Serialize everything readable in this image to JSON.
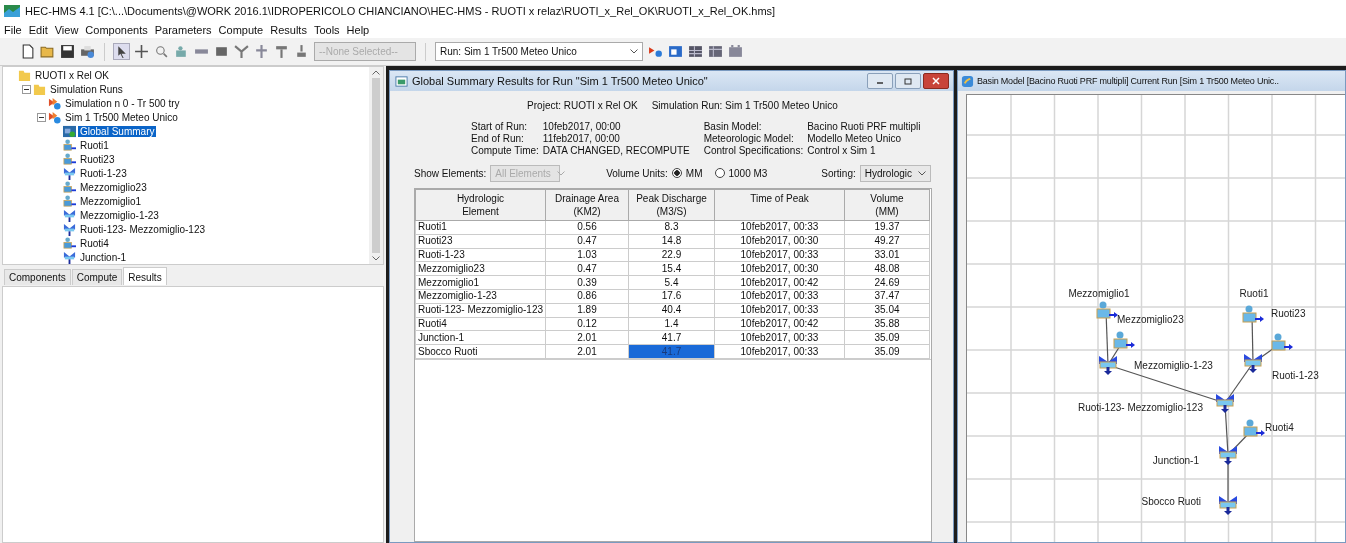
{
  "window": {
    "title": "HEC-HMS 4.1 [C:\\...\\Documents\\@WORK 2016.1\\IDROPERICOLO CHIANCIANO\\HEC-HMS - RUOTI x relaz\\RUOTI_x_Rel_OK\\RUOTI_x_Rel_OK.hms]"
  },
  "menu": [
    "File",
    "Edit",
    "View",
    "Components",
    "Parameters",
    "Compute",
    "Results",
    "Tools",
    "Help"
  ],
  "toolbar": {
    "element_select": {
      "value": "--None Selected--",
      "disabled": true
    },
    "run_select": {
      "value": "Run: Sim 1 Tr500 Meteo Unico"
    }
  },
  "tree": [
    {
      "label": "RUOTI x Rel OK",
      "kind": "project",
      "selected": false,
      "children": [
        {
          "label": "Simulation Runs",
          "kind": "folder",
          "expanded": true,
          "selected": false,
          "children": [
            {
              "label": "Simulation n 0 - Tr 500 try",
              "kind": "run",
              "selected": false
            },
            {
              "label": "Sim 1 Tr500 Meteo Unico",
              "kind": "run",
              "expanded": true,
              "selected": false,
              "children": [
                {
                  "label": "Global Summary",
                  "kind": "summary",
                  "selected": true
                },
                {
                  "label": "Ruoti1",
                  "kind": "subbasin",
                  "selected": false
                },
                {
                  "label": "Ruoti23",
                  "kind": "subbasin",
                  "selected": false
                },
                {
                  "label": "Ruoti-1-23",
                  "kind": "junction",
                  "selected": false
                },
                {
                  "label": "Mezzomiglio23",
                  "kind": "subbasin",
                  "selected": false
                },
                {
                  "label": "Mezzomiglio1",
                  "kind": "subbasin",
                  "selected": false
                },
                {
                  "label": "Mezzomiglio-1-23",
                  "kind": "junction",
                  "selected": false
                },
                {
                  "label": "Ruoti-123- Mezzomiglio-123",
                  "kind": "junction",
                  "selected": false
                },
                {
                  "label": "Ruoti4",
                  "kind": "subbasin",
                  "selected": false
                },
                {
                  "label": "Junction-1",
                  "kind": "junction",
                  "selected": false
                }
              ]
            }
          ]
        }
      ]
    }
  ],
  "tabs": [
    {
      "label": "Components",
      "selected": false
    },
    {
      "label": "Compute",
      "selected": false
    },
    {
      "label": "Results",
      "selected": true
    }
  ],
  "summary_window": {
    "title": "Global Summary Results for Run \"Sim 1 Tr500 Meteo Unico\"",
    "project": "Project: RUOTI x Rel OK",
    "simulation_run": "Simulation Run: Sim 1 Tr500 Meteo Unico",
    "info": [
      {
        "label": "Start of Run:",
        "value": "10feb2017, 00:00"
      },
      {
        "label": "End of Run:",
        "value": "11feb2017, 00:00"
      },
      {
        "label": "Compute Time:",
        "value": "DATA CHANGED, RECOMPUTE"
      }
    ],
    "info_right": [
      {
        "label": "Basin Model:",
        "value": "Bacino Ruoti PRF multipli"
      },
      {
        "label": "Meteorologic Model:",
        "value": "Modello Meteo Unico"
      },
      {
        "label": "Control Specifications:",
        "value": "Control x Sim 1"
      }
    ],
    "show_elements": {
      "label": "Show Elements:",
      "value": "All Elements",
      "disabled": true
    },
    "volume_units": {
      "label": "Volume Units:",
      "options": [
        {
          "label": "MM",
          "selected": true
        },
        {
          "label": "1000 M3",
          "selected": false
        }
      ]
    },
    "sorting": {
      "label": "Sorting:",
      "value": "Hydrologic"
    },
    "columns": [
      "Hydrologic\nElement",
      "Drainage Area\n(KM2)",
      "Peak Discharge\n(M3/S)",
      "Time of Peak",
      "Volume\n(MM)"
    ],
    "rows": [
      {
        "cells": [
          "Ruoti1",
          "0.56",
          "8.3",
          "10feb2017, 00:33",
          "19.37"
        ],
        "peak_selected": false
      },
      {
        "cells": [
          "Ruoti23",
          "0.47",
          "14.8",
          "10feb2017, 00:30",
          "49.27"
        ],
        "peak_selected": false
      },
      {
        "cells": [
          "Ruoti-1-23",
          "1.03",
          "22.9",
          "10feb2017, 00:33",
          "33.01"
        ],
        "peak_selected": false
      },
      {
        "cells": [
          "Mezzomiglio23",
          "0.47",
          "15.4",
          "10feb2017, 00:30",
          "48.08"
        ],
        "peak_selected": false
      },
      {
        "cells": [
          "Mezzomiglio1",
          "0.39",
          "5.4",
          "10feb2017, 00:42",
          "24.69"
        ],
        "peak_selected": false
      },
      {
        "cells": [
          "Mezzomiglio-1-23",
          "0.86",
          "17.6",
          "10feb2017, 00:33",
          "37.47"
        ],
        "peak_selected": false
      },
      {
        "cells": [
          "Ruoti-123- Mezzomiglio-123",
          "1.89",
          "40.4",
          "10feb2017, 00:33",
          "35.04"
        ],
        "peak_selected": false
      },
      {
        "cells": [
          "Ruoti4",
          "0.12",
          "1.4",
          "10feb2017, 00:42",
          "35.88"
        ],
        "peak_selected": false
      },
      {
        "cells": [
          "Junction-1",
          "2.01",
          "41.7",
          "10feb2017, 00:33",
          "35.09"
        ],
        "peak_selected": false
      },
      {
        "cells": [
          "Sbocco Ruoti",
          "2.01",
          "41.7",
          "10feb2017, 00:33",
          "35.09"
        ],
        "peak_selected": true
      }
    ]
  },
  "basin_window": {
    "title": "Basin Model [Bacino Ruoti PRF multipli] Current Run [Sim 1 Tr500 Meteo Unic..",
    "nodes": [
      {
        "label": "Mezzomiglio1",
        "kind": "subbasin"
      },
      {
        "label": "Mezzomiglio23",
        "kind": "subbasin"
      },
      {
        "label": "Mezzomiglio-1-23",
        "kind": "junction"
      },
      {
        "label": "Ruoti1",
        "kind": "subbasin"
      },
      {
        "label": "Ruoti23",
        "kind": "subbasin"
      },
      {
        "label": "Ruoti-1-23",
        "kind": "junction"
      },
      {
        "label": "Ruoti-123- Mezzomiglio-123",
        "kind": "junction"
      },
      {
        "label": "Ruoti4",
        "kind": "subbasin"
      },
      {
        "label": "Junction-1",
        "kind": "junction"
      },
      {
        "label": "Sbocco Ruoti",
        "kind": "junction"
      }
    ]
  }
}
